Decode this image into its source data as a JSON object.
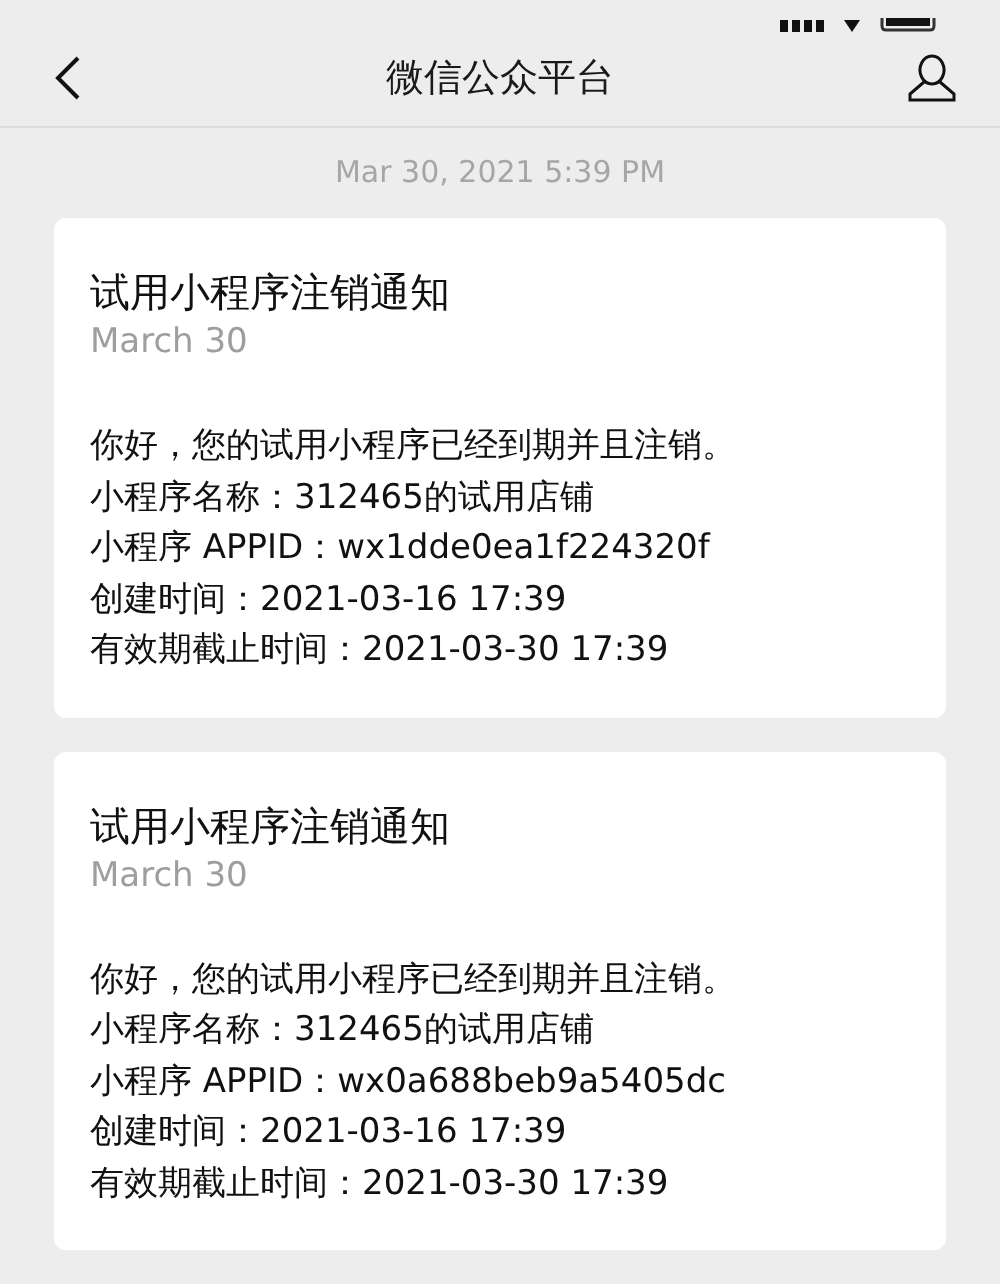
{
  "nav_bar": {
    "title": "微信公众平台"
  },
  "timestamp": "Mar 30, 2021 5:39 PM",
  "messages": [
    {
      "title": "试用小程序注销通知",
      "date": "March 30",
      "lines": [
        "你好，您的试用小程序已经到期并且注销。",
        "小程序名称：312465的试用店铺",
        "小程序 APPID：wx1dde0ea1f224320f",
        "创建时间：2021-03-16 17:39",
        "有效期截止时间：2021-03-30 17:39"
      ]
    },
    {
      "title": "试用小程序注销通知",
      "date": "March 30",
      "lines": [
        "你好，您的试用小程序已经到期并且注销。",
        "小程序名称：312465的试用店铺",
        "小程序 APPID：wx0a688beb9a5405dc",
        "创建时间：2021-03-16 17:39",
        "有效期截止时间：2021-03-30 17:39"
      ]
    }
  ]
}
